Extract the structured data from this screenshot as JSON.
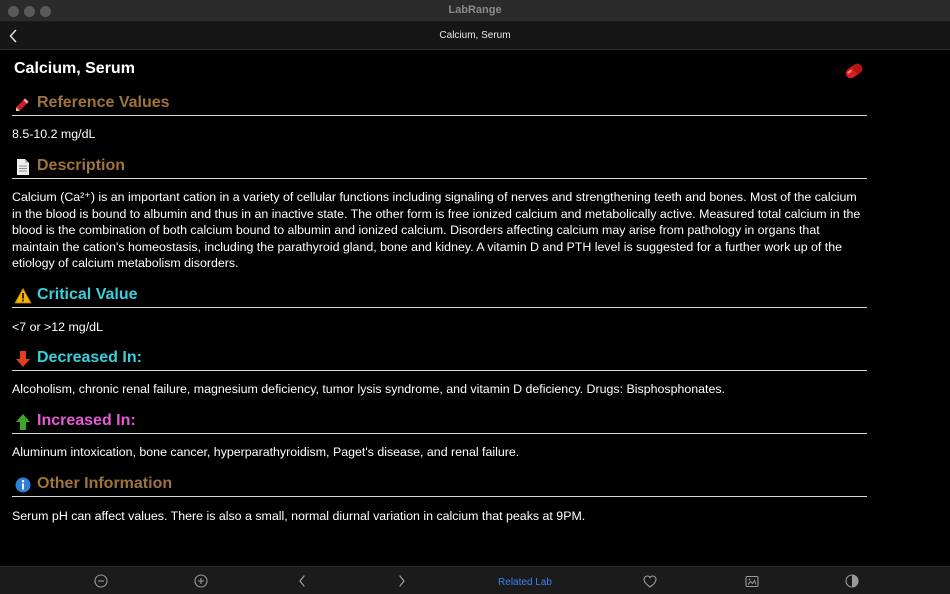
{
  "window": {
    "app_title": "LabRange"
  },
  "navbar": {
    "title": "Calcium, Serum"
  },
  "page": {
    "title": "Calcium, Serum"
  },
  "sections": {
    "reference": {
      "title": "Reference Values",
      "body": "8.5-10.2 mg/dL",
      "icon": "pencil-icon",
      "color": "#a0733a"
    },
    "description": {
      "title": "Description",
      "body": "Calcium (Ca²⁺) is an important cation in a variety of cellular functions including signaling of nerves and strengthening teeth and bones. Most of the calcium in the blood is bound to albumin and thus in an inactive state. The other form is free ionized calcium and metabolically active. Measured total calcium in the blood is the combination of both calcium bound to albumin and ionized calcium. Disorders affecting calcium may arise from pathology in organs that maintain the cation's homeostasis, including the parathyroid gland, bone and kidney. A vitamin D and PTH level is suggested for a further work up of the etiology of calcium metabolism disorders.",
      "icon": "document-icon",
      "color": "#a0733a"
    },
    "critical": {
      "title": "Critical Value",
      "body": "<7 or >12 mg/dL",
      "icon": "warning-icon",
      "color": "#39d0dc"
    },
    "decreased": {
      "title": "Decreased In:",
      "body": "Alcoholism, chronic renal failure, magnesium deficiency, tumor lysis syndrome, and vitamin D deficiency. Drugs: Bisphosphonates.",
      "icon": "arrow-down-icon",
      "color": "#39d0dc"
    },
    "increased": {
      "title": "Increased In:",
      "body": "Aluminum intoxication, bone cancer, hyperparathyroidism, Paget's disease, and renal failure.",
      "icon": "arrow-up-icon",
      "color": "#e55ad6"
    },
    "other": {
      "title": "Other Information",
      "body": "Serum pH can affect values. There is also a small, normal diurnal variation in calcium that peaks at 9PM.",
      "icon": "info-icon",
      "color": "#a0733a"
    }
  },
  "toolbar": {
    "related_label": "Related Lab",
    "icons": [
      "zoom-out-icon",
      "zoom-in-icon",
      "previous-icon",
      "next-icon",
      "favorite-icon",
      "image-icon",
      "contrast-icon"
    ],
    "accent": "#3a82f6"
  }
}
